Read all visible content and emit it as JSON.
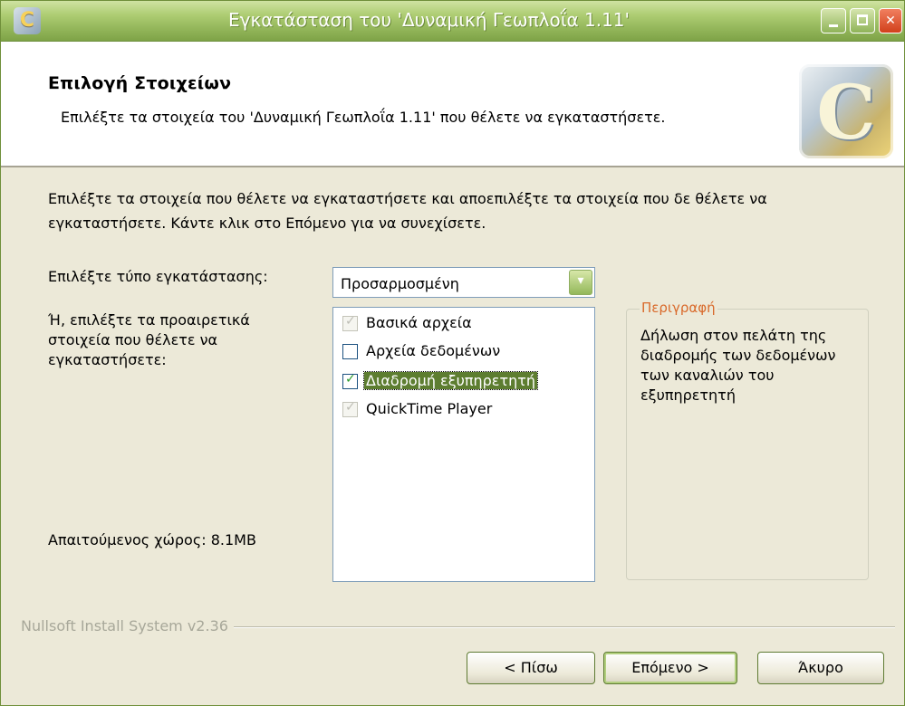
{
  "window": {
    "title": "Εγκατάσταση του 'Δυναμική Γεωπλοΐα 1.11'"
  },
  "header": {
    "title": "Επιλογή Στοιχείων",
    "subtitle": "Επιλέξτε τα στοιχεία του 'Δυναμική Γεωπλοΐα 1.11' που θέλετε να εγκαταστήσετε."
  },
  "body": {
    "intro": "Επιλέξτε τα στοιχεία που θέλετε να εγκαταστήσετε και αποεπιλέξτε τα στοιχεία που δε θέλετε να εγκαταστήσετε. Κάντε κλικ στο Επόμενο για να συνεχίσετε.",
    "install_type_label": "Επιλέξτε τύπο εγκατάστασης:",
    "install_type_value": "Προσαρμοσμένη",
    "optional_label": "Ή, επιλέξτε τα προαιρετικά στοιχεία που θέλετε να εγκαταστήσετε:",
    "space_required": "Απαιτούμενος χώρος: 8.1MB",
    "components": [
      {
        "label": "Βασικά αρχεία",
        "checked": true,
        "disabled": true
      },
      {
        "label": "Αρχεία δεδομένων",
        "checked": false,
        "disabled": false
      },
      {
        "label": "Διαδρομή εξυπηρετητή",
        "checked": true,
        "disabled": false,
        "selected": true
      },
      {
        "label": "QuickTime Player",
        "checked": true,
        "disabled": true
      }
    ],
    "description": {
      "title": "Περιγραφή",
      "text": "Δήλωση στον πελάτη της διαδρομής των δεδομένων των καναλιών του εξυπηρετητή"
    }
  },
  "footer": {
    "branding": "Nullsoft Install System v2.36",
    "back_label": "< Πίσω",
    "next_label": "Επόμενο >",
    "cancel_label": "Άκυρο"
  },
  "colors": {
    "titlebar": "#93b65a",
    "accent": "#5d7d30",
    "legend": "#d96a2b",
    "face": "#ece9d8"
  }
}
